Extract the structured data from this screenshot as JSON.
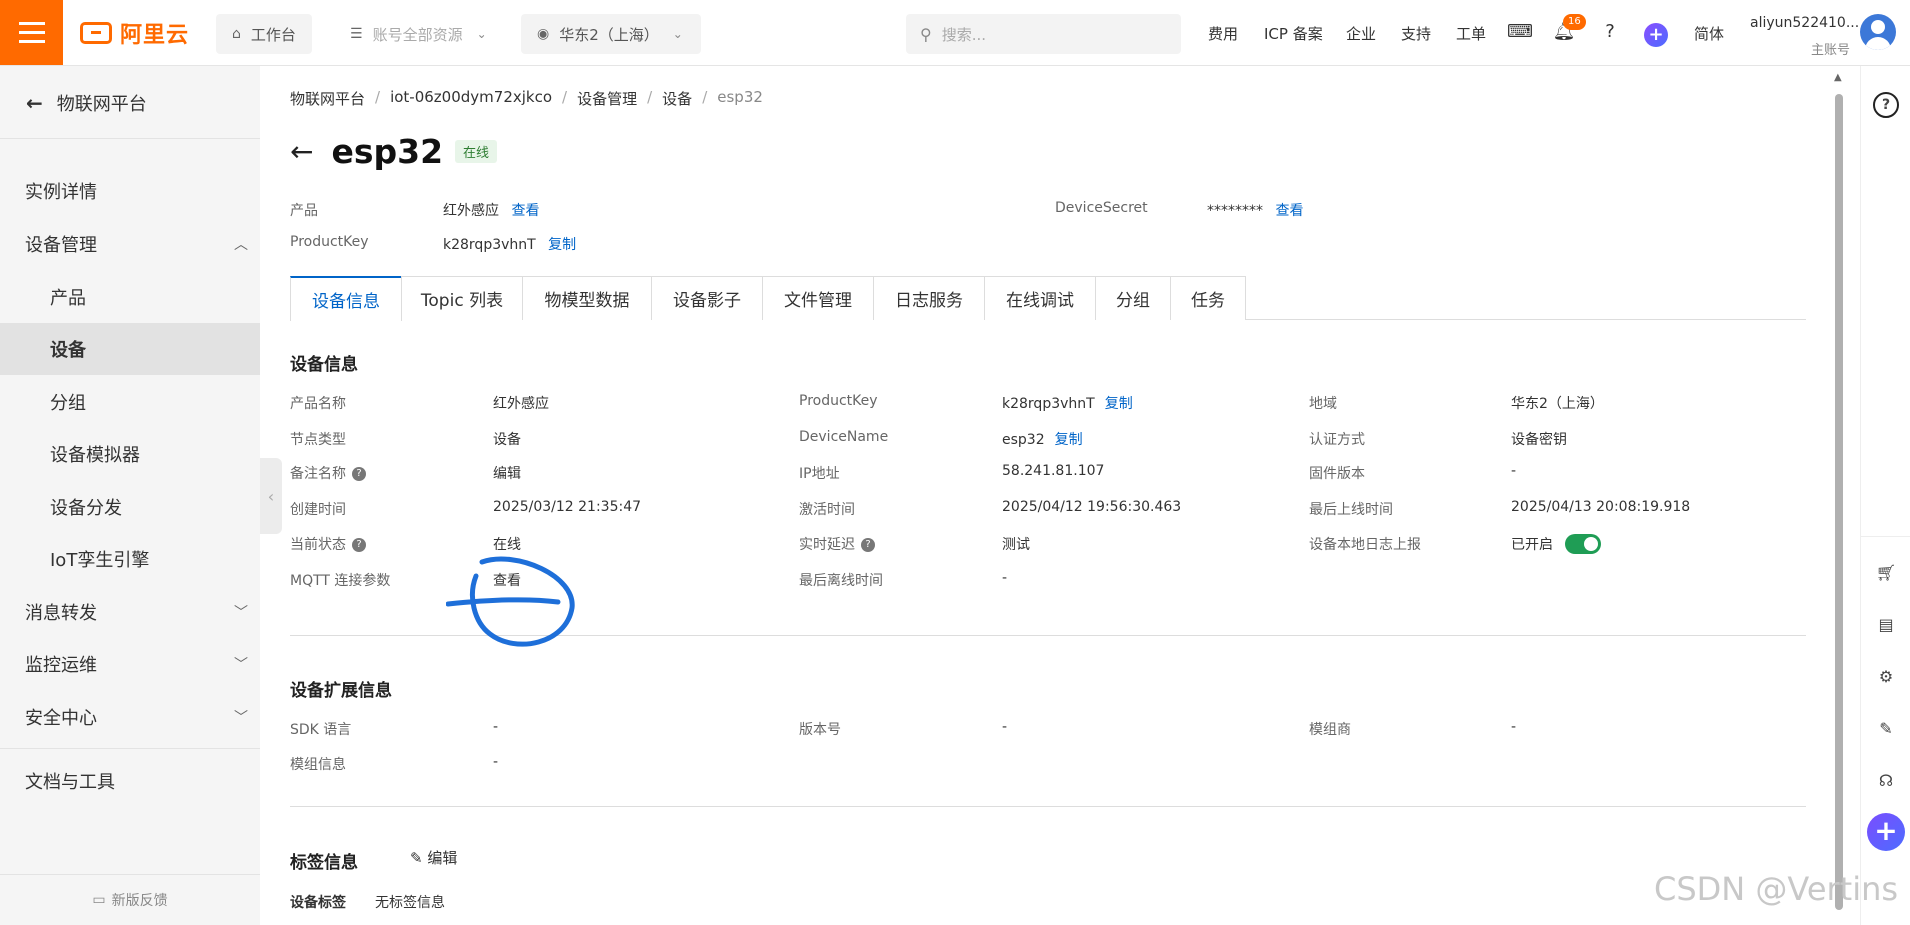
{
  "topbar": {
    "logo_text": "阿里云",
    "workbench": "工作台",
    "resources": "账号全部资源",
    "region": "华东2（上海）",
    "search_placeholder": "搜索...",
    "links": [
      "费用",
      "ICP 备案",
      "企业",
      "支持",
      "工单"
    ],
    "notif_count": "16",
    "lang": "简体",
    "user_name": "aliyun522410...",
    "user_role": "主账号"
  },
  "sidebar": {
    "back_label": "物联网平台",
    "items": [
      "实例详情",
      "设备管理",
      "产品",
      "设备",
      "分组",
      "设备模拟器",
      "设备分发",
      "IoT孪生引擎",
      "消息转发",
      "监控运维",
      "安全中心",
      "文档与工具"
    ],
    "feedback": "新版反馈"
  },
  "breadcrumb": [
    "物联网平台",
    "iot-06z00dym72xjkco",
    "设备管理",
    "设备",
    "esp32"
  ],
  "device": {
    "name": "esp32",
    "status": "在线",
    "product_label": "产品",
    "product_value": "红外感应",
    "view": "查看",
    "productkey_label": "ProductKey",
    "productkey_value": "k28rqp3vhnT",
    "copy": "复制",
    "secret_label": "DeviceSecret",
    "secret_value": "********"
  },
  "tabs": [
    "设备信息",
    "Topic 列表",
    "物模型数据",
    "设备影子",
    "文件管理",
    "日志服务",
    "在线调试",
    "分组",
    "任务"
  ],
  "info": {
    "title": "设备信息",
    "col1": [
      {
        "k": "产品名称",
        "v": "红外感应"
      },
      {
        "k": "节点类型",
        "v": "设备"
      },
      {
        "k": "备注名称",
        "v": "编辑"
      },
      {
        "k": "创建时间",
        "v": "2025/03/12 21:35:47"
      },
      {
        "k": "当前状态",
        "v": "在线"
      },
      {
        "k": "MQTT 连接参数",
        "v": "查看"
      }
    ],
    "col2": [
      {
        "k": "ProductKey",
        "v": "k28rqp3vhnT",
        "action": "复制"
      },
      {
        "k": "DeviceName",
        "v": "esp32",
        "action": "复制"
      },
      {
        "k": "IP地址",
        "v": "58.241.81.107"
      },
      {
        "k": "激活时间",
        "v": "2025/04/12 19:56:30.463"
      },
      {
        "k": "实时延迟",
        "v": "测试"
      },
      {
        "k": "最后离线时间",
        "v": "-"
      }
    ],
    "col3": [
      {
        "k": "地域",
        "v": "华东2（上海）"
      },
      {
        "k": "认证方式",
        "v": "设备密钥"
      },
      {
        "k": "固件版本",
        "v": "-"
      },
      {
        "k": "最后上线时间",
        "v": "2025/04/13 20:08:19.918"
      },
      {
        "k": "设备本地日志上报",
        "v": "已开启"
      }
    ]
  },
  "ext": {
    "title": "设备扩展信息",
    "rows": [
      {
        "k": "SDK 语言",
        "v": "-"
      },
      {
        "k": "版本号",
        "v": "-"
      },
      {
        "k": "模组商",
        "v": "-"
      },
      {
        "k": "模组信息",
        "v": "-"
      }
    ]
  },
  "tags": {
    "title": "标签信息",
    "edit": "编辑",
    "label": "设备标签",
    "value": "无标签信息"
  },
  "watermark": "CSDN @Vertins",
  "colors": {
    "brand": "#ff6a00",
    "link": "#0064c8",
    "online": "#1f9d55"
  }
}
